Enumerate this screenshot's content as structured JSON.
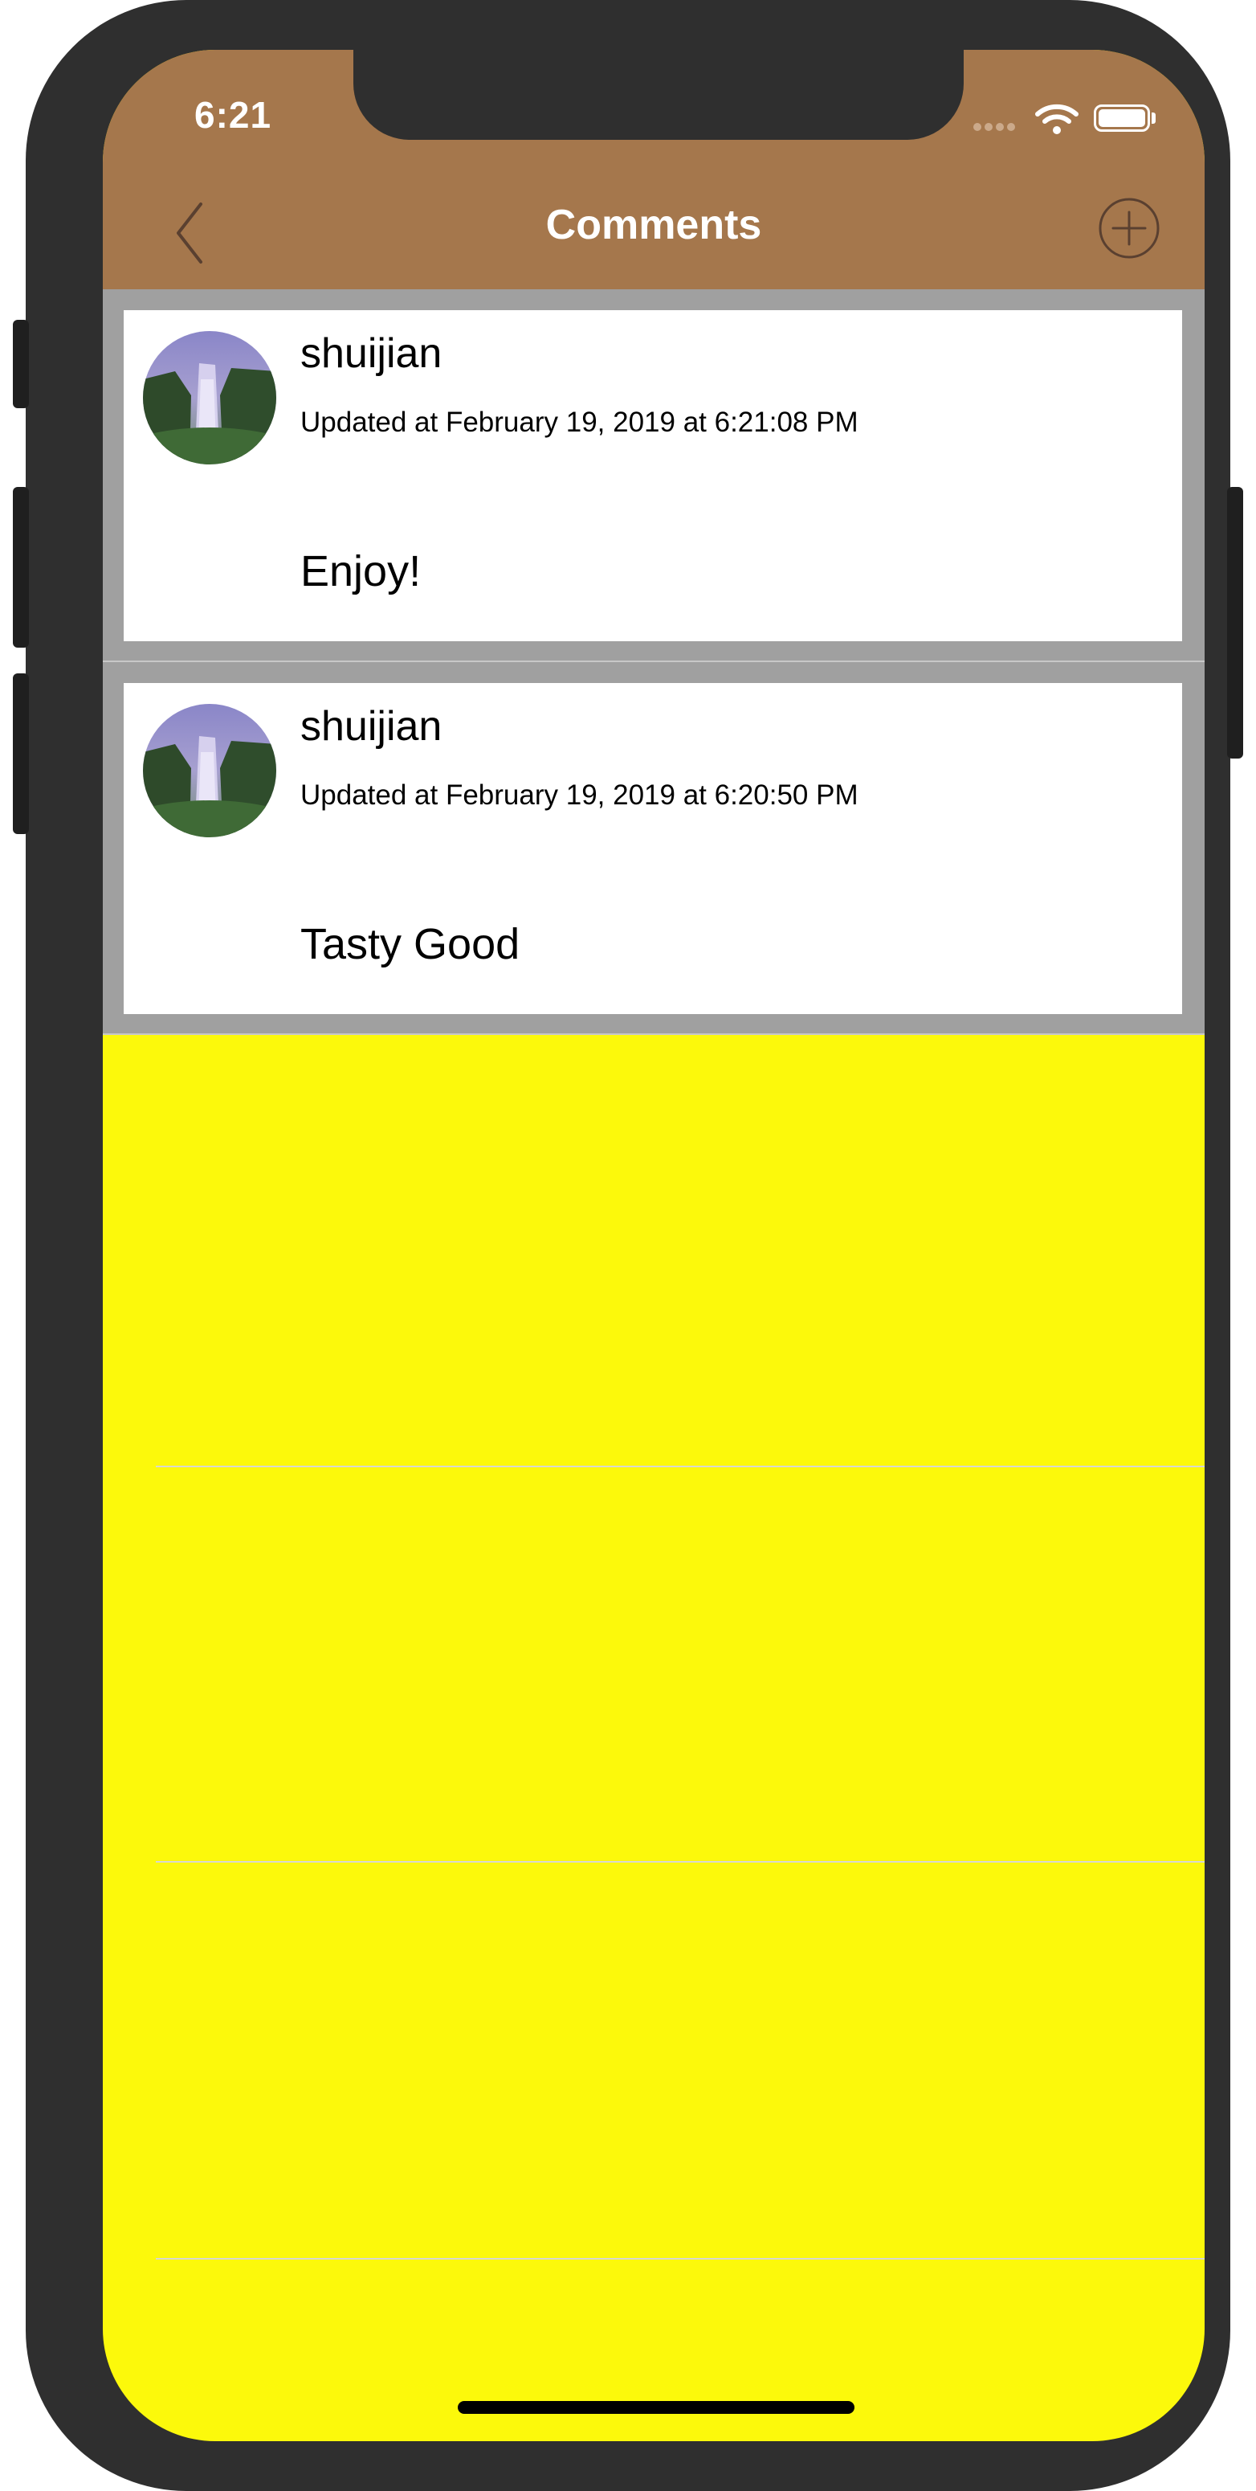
{
  "status_bar": {
    "time": "6:21"
  },
  "nav": {
    "title": "Comments",
    "back_icon": "chevron-left-icon",
    "add_icon": "plus-circle-icon"
  },
  "colors": {
    "navbar": "#a5774c",
    "background": "#fcf90b",
    "cell_border": "#a0a0a0"
  },
  "comments": [
    {
      "username": "shuijian",
      "timestamp": "Updated at February 19, 2019 at 6:21:08 PM",
      "text": "Enjoy!",
      "avatar_icon": "waterfall-avatar"
    },
    {
      "username": "shuijian",
      "timestamp": "Updated at February 19, 2019 at 6:20:50 PM",
      "text": "Tasty Good",
      "avatar_icon": "waterfall-avatar"
    }
  ]
}
